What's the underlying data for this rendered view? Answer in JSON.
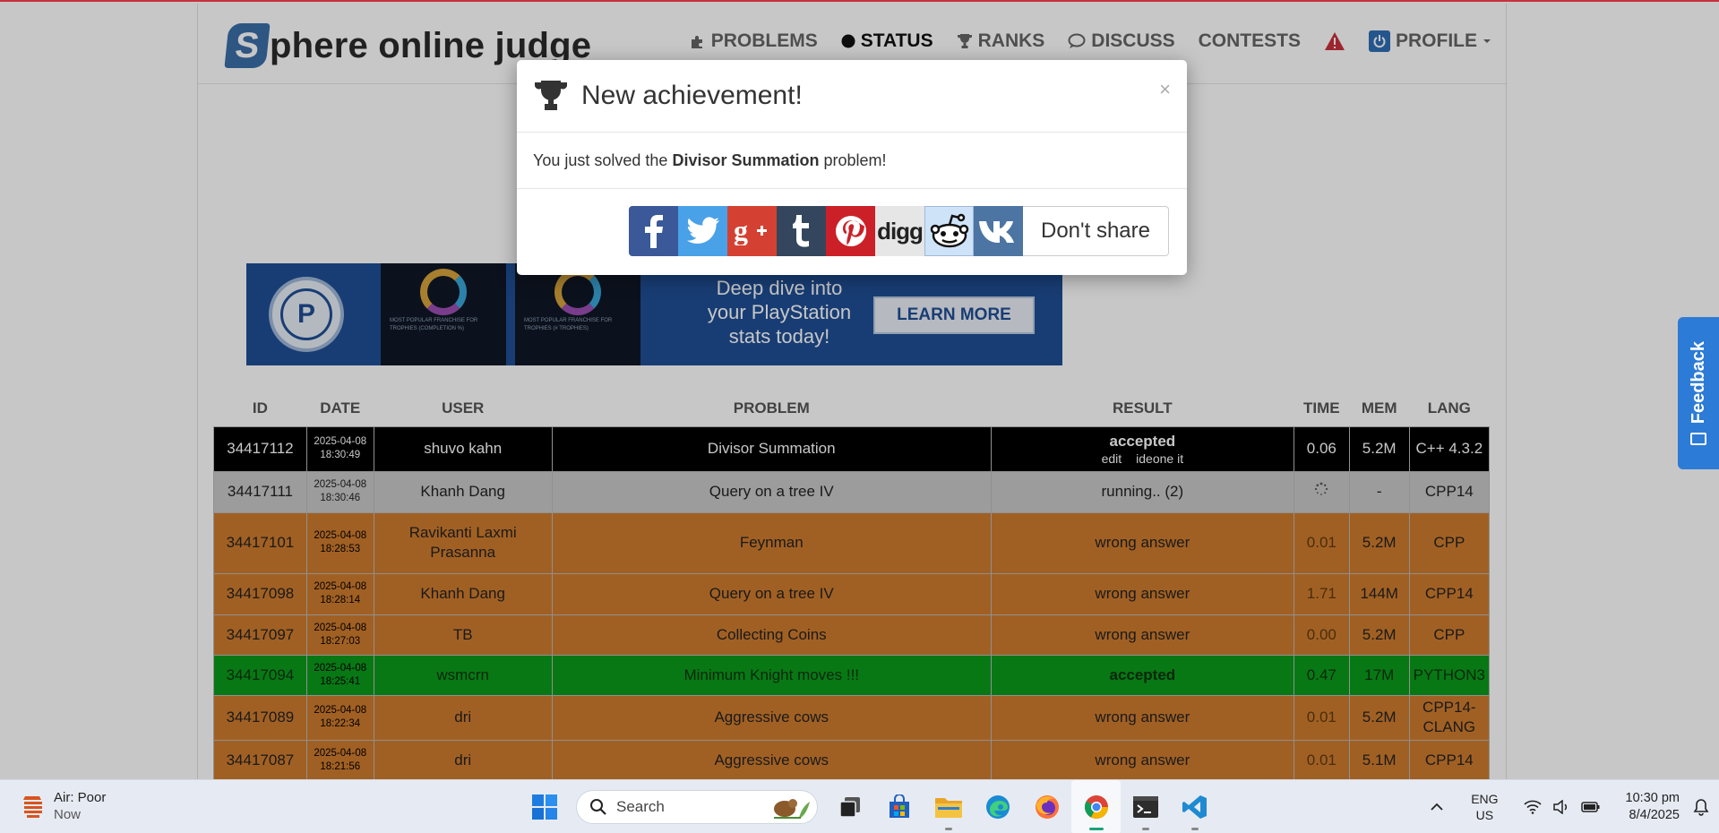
{
  "site": {
    "logo_letter": "S",
    "logo_text": "phere online judge",
    "nav": [
      {
        "label": "PROBLEMS",
        "icon": "puzzle-icon"
      },
      {
        "label": "STATUS",
        "icon": "circle-icon"
      },
      {
        "label": "RANKS",
        "icon": "trophy-icon"
      },
      {
        "label": "DISCUSS",
        "icon": "chat-icon"
      },
      {
        "label": "CONTESTS",
        "icon": ""
      },
      {
        "label": "PROFILE",
        "icon": "power-icon"
      }
    ]
  },
  "ad": {
    "text_line1": "Deep dive into",
    "text_line2": "your PlayStation",
    "text_line3": "stats today!",
    "button": "LEARN MORE",
    "logo_letter": "P",
    "shot_caption_1": "MOST POPULAR FRANCHISE FOR TROPHIES (COMPLETION %)",
    "shot_caption_2": "MOST POPULAR FRANCHISE FOR TROPHIES (# TROPHIES)"
  },
  "table": {
    "headers": [
      "ID",
      "DATE",
      "USER",
      "PROBLEM",
      "RESULT",
      "TIME",
      "MEM",
      "LANG"
    ],
    "rows": [
      {
        "style": "black",
        "id": "34417112",
        "date": "2025-04-08",
        "time_of_day": "18:30:49",
        "user": "shuvo kahn",
        "problem": "Divisor Summation",
        "result": "accepted",
        "links": [
          "edit",
          "ideone it"
        ],
        "time": "0.06",
        "mem": "5.2M",
        "lang": "C++ 4.3.2"
      },
      {
        "style": "gray",
        "id": "34417111",
        "date": "2025-04-08",
        "time_of_day": "18:30:46",
        "user": "Khanh Dang",
        "problem": "Query on a tree IV",
        "result": "running.. (2)",
        "links": [],
        "time": "",
        "mem": "-",
        "lang": "CPP14"
      },
      {
        "style": "orange",
        "id": "34417101",
        "date": "2025-04-08",
        "time_of_day": "18:28:53",
        "user": "Ravikanti Laxmi Prasanna",
        "problem": "Feynman",
        "result": "wrong answer",
        "links": [],
        "time": "0.01",
        "mem": "5.2M",
        "lang": "CPP"
      },
      {
        "style": "orange",
        "id": "34417098",
        "date": "2025-04-08",
        "time_of_day": "18:28:14",
        "user": "Khanh Dang",
        "problem": "Query on a tree IV",
        "result": "wrong answer",
        "links": [],
        "time": "1.71",
        "mem": "144M",
        "lang": "CPP14"
      },
      {
        "style": "orange",
        "id": "34417097",
        "date": "2025-04-08",
        "time_of_day": "18:27:03",
        "user": "TB",
        "problem": "Collecting Coins",
        "result": "wrong answer",
        "links": [],
        "time": "0.00",
        "mem": "5.2M",
        "lang": "CPP"
      },
      {
        "style": "green",
        "id": "34417094",
        "date": "2025-04-08",
        "time_of_day": "18:25:41",
        "user": "wsmcrn",
        "problem": "Minimum Knight moves !!!",
        "result": "accepted",
        "links": [],
        "time": "0.47",
        "mem": "17M",
        "lang": "PYTHON3"
      },
      {
        "style": "orange",
        "id": "34417089",
        "date": "2025-04-08",
        "time_of_day": "18:22:34",
        "user": "dri",
        "problem": "Aggressive cows",
        "result": "wrong answer",
        "links": [],
        "time": "0.01",
        "mem": "5.2M",
        "lang": "CPP14-CLANG"
      },
      {
        "style": "orange",
        "id": "34417087",
        "date": "2025-04-08",
        "time_of_day": "18:21:56",
        "user": "dri",
        "problem": "Aggressive cows",
        "result": "wrong answer",
        "links": [],
        "time": "0.01",
        "mem": "5.1M",
        "lang": "CPP14"
      }
    ]
  },
  "modal": {
    "title": "New achievement!",
    "body_prefix": "You just solved the",
    "problem": "Divisor Summation",
    "body_suffix": "problem!",
    "close": "×",
    "dont_share": "Don't share",
    "share_digg_label": "digg"
  },
  "feedback": {
    "label": "Feedback"
  },
  "taskbar": {
    "weather_title": "Air: Poor",
    "weather_sub": "Now",
    "search_placeholder": "Search",
    "lang_top": "ENG",
    "lang_bottom": "US",
    "time": "10:30 pm",
    "date": "8/4/2025"
  },
  "colors": {
    "accepted_row": "#0b9a1c",
    "wrong_row": "#cf7c2e",
    "running_row": "#c8c8c8",
    "highlight_row": "#000000",
    "brand_blue": "#3a6fa8"
  }
}
